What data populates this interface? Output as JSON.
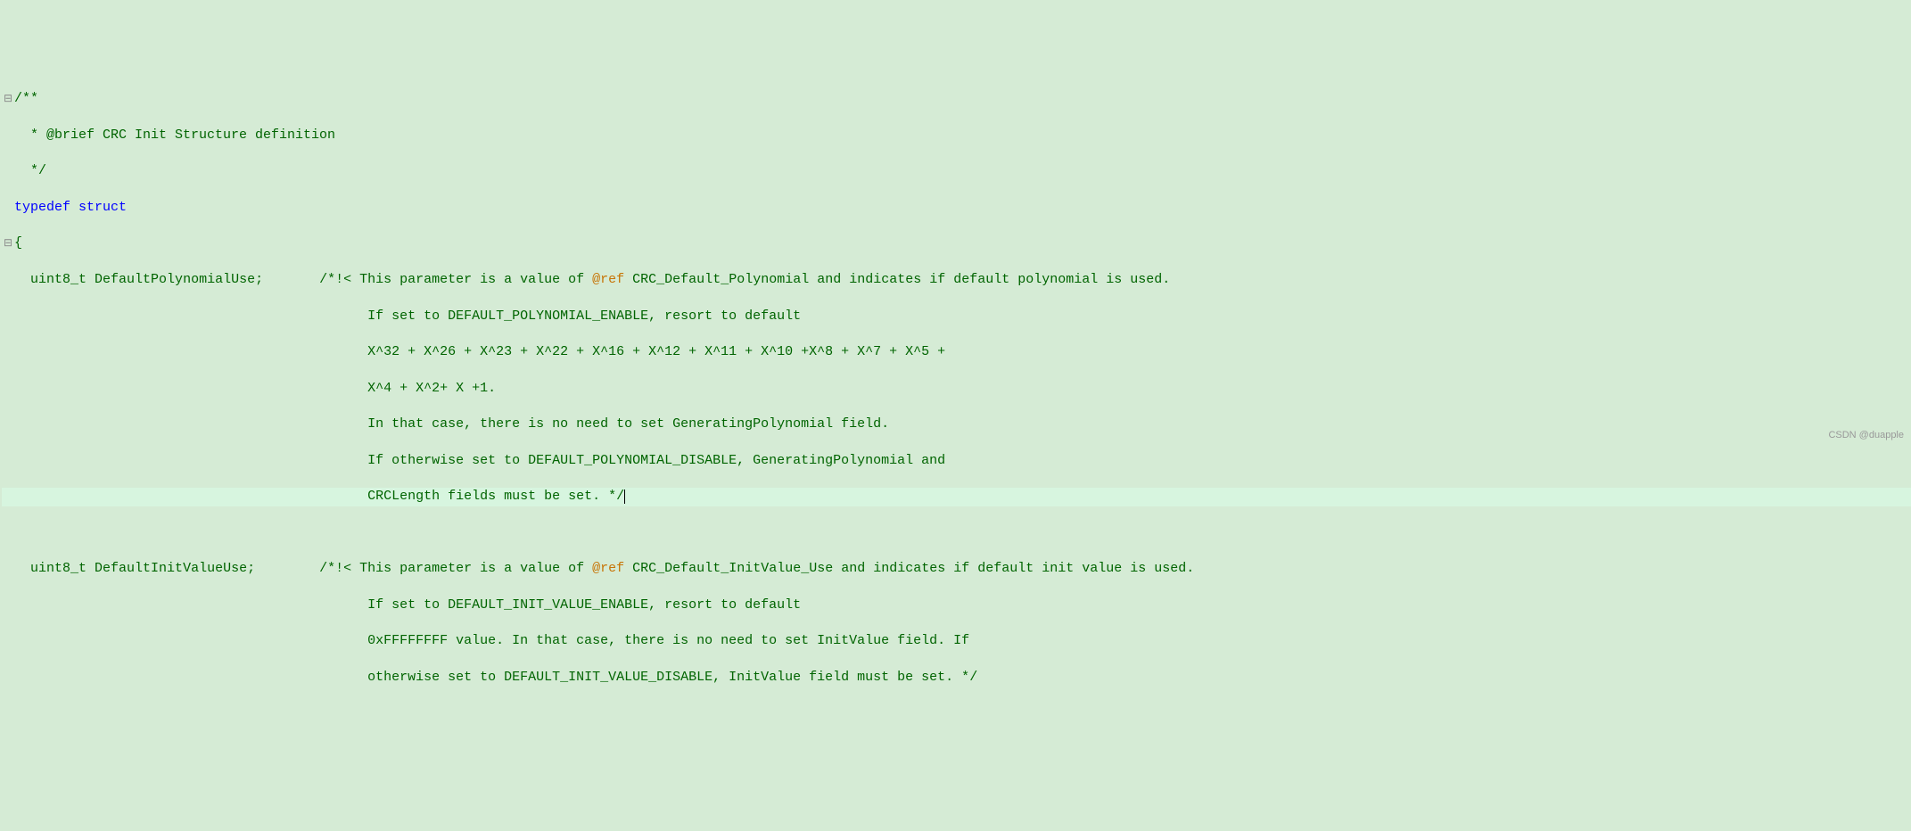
{
  "code": {
    "line1": "/**",
    "line2": "  * @brief CRC Init Structure definition",
    "line3": "  */",
    "typedef": "typedef",
    "struct": "struct",
    "brace_open": "{",
    "field1_type": "uint8_t",
    "field1_name": "DefaultPolynomialUse;",
    "comment1_start": "/*!< This parameter is a value of ",
    "ref_tag1": "@ref",
    "comment1_ref": " CRC_Default_Polynomial and indicates if default polynomial is used.",
    "comment1_l2": "If set to DEFAULT_POLYNOMIAL_ENABLE, resort to default",
    "comment1_l3": "X^32 + X^26 + X^23 + X^22 + X^16 + X^12 + X^11 + X^10 +X^8 + X^7 + X^5 +",
    "comment1_l4": "X^4 + X^2+ X +1.",
    "comment1_l5": "In that case, there is no need to set GeneratingPolynomial field.",
    "comment1_l6": "If otherwise set to DEFAULT_POLYNOMIAL_DISABLE, GeneratingPolynomial and",
    "comment1_l7": "CRCLength fields must be set. */",
    "field2_type": "uint8_t",
    "field2_name": "DefaultInitValueUse;",
    "comment2_start": "/*!< This parameter is a value of ",
    "ref_tag2": "@ref",
    "comment2_ref": " CRC_Default_InitValue_Use and indicates if default init value is used.",
    "comment2_l2": "If set to DEFAULT_INIT_VALUE_ENABLE, resort to default",
    "comment2_l3": "0xFFFFFFFF value. In that case, there is no need to set InitValue field. If",
    "comment2_l4": "otherwise set to DEFAULT_INIT_VALUE_DISABLE, InitValue field must be set. */"
  },
  "watermark": "CSDN @duapple",
  "fold_open": "⊟",
  "fold_none": " "
}
